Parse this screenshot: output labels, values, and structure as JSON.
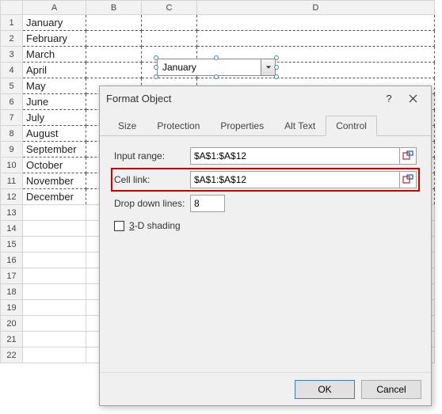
{
  "columns": [
    "",
    "A",
    "B",
    "C",
    "D"
  ],
  "rows": [
    {
      "n": "1",
      "a": "January"
    },
    {
      "n": "2",
      "a": "February"
    },
    {
      "n": "3",
      "a": "March"
    },
    {
      "n": "4",
      "a": "April"
    },
    {
      "n": "5",
      "a": "May"
    },
    {
      "n": "6",
      "a": "June"
    },
    {
      "n": "7",
      "a": "July"
    },
    {
      "n": "8",
      "a": "August"
    },
    {
      "n": "9",
      "a": "September"
    },
    {
      "n": "10",
      "a": "October"
    },
    {
      "n": "11",
      "a": "November"
    },
    {
      "n": "12",
      "a": "December"
    },
    {
      "n": "13",
      "a": ""
    },
    {
      "n": "14",
      "a": ""
    },
    {
      "n": "15",
      "a": ""
    },
    {
      "n": "16",
      "a": ""
    },
    {
      "n": "17",
      "a": ""
    },
    {
      "n": "18",
      "a": ""
    },
    {
      "n": "19",
      "a": ""
    },
    {
      "n": "20",
      "a": ""
    },
    {
      "n": "21",
      "a": ""
    },
    {
      "n": "22",
      "a": ""
    }
  ],
  "combo": {
    "value": "January"
  },
  "dialog": {
    "title": "Format Object",
    "help": "?",
    "close": "✕",
    "tabs": {
      "size": "Size",
      "protection": "Protection",
      "properties": "Properties",
      "alttext": "Alt Text",
      "control": "Control"
    },
    "labels": {
      "input_range": "Input range:",
      "cell_link": "Cell link:",
      "dropdown_lines": "Drop down lines:",
      "shading": "3-D shading"
    },
    "values": {
      "input_range": "$A$1:$A$12",
      "cell_link": "$A$1:$A$12",
      "dropdown_lines": "8"
    },
    "buttons": {
      "ok": "OK",
      "cancel": "Cancel"
    }
  }
}
